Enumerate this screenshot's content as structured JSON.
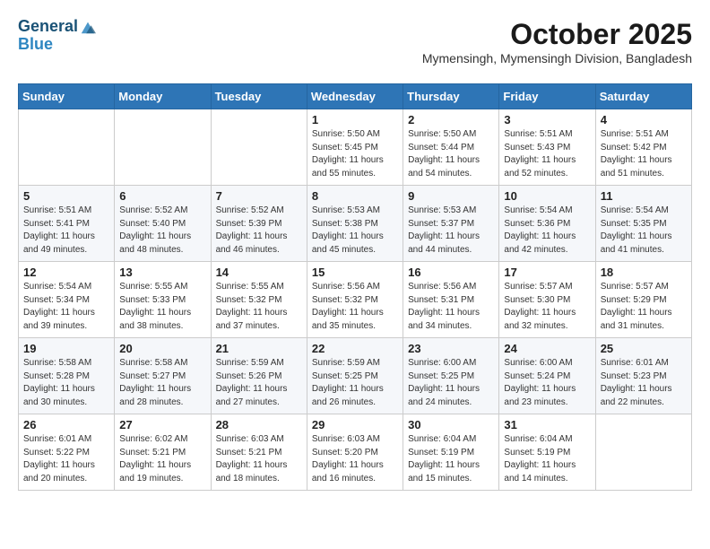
{
  "header": {
    "logo_line1": "General",
    "logo_line2": "Blue",
    "title": "October 2025",
    "subtitle": "Mymensingh, Mymensingh Division, Bangladesh"
  },
  "weekdays": [
    "Sunday",
    "Monday",
    "Tuesday",
    "Wednesday",
    "Thursday",
    "Friday",
    "Saturday"
  ],
  "weeks": [
    [
      {
        "day": "",
        "info": ""
      },
      {
        "day": "",
        "info": ""
      },
      {
        "day": "",
        "info": ""
      },
      {
        "day": "1",
        "info": "Sunrise: 5:50 AM\nSunset: 5:45 PM\nDaylight: 11 hours\nand 55 minutes."
      },
      {
        "day": "2",
        "info": "Sunrise: 5:50 AM\nSunset: 5:44 PM\nDaylight: 11 hours\nand 54 minutes."
      },
      {
        "day": "3",
        "info": "Sunrise: 5:51 AM\nSunset: 5:43 PM\nDaylight: 11 hours\nand 52 minutes."
      },
      {
        "day": "4",
        "info": "Sunrise: 5:51 AM\nSunset: 5:42 PM\nDaylight: 11 hours\nand 51 minutes."
      }
    ],
    [
      {
        "day": "5",
        "info": "Sunrise: 5:51 AM\nSunset: 5:41 PM\nDaylight: 11 hours\nand 49 minutes."
      },
      {
        "day": "6",
        "info": "Sunrise: 5:52 AM\nSunset: 5:40 PM\nDaylight: 11 hours\nand 48 minutes."
      },
      {
        "day": "7",
        "info": "Sunrise: 5:52 AM\nSunset: 5:39 PM\nDaylight: 11 hours\nand 46 minutes."
      },
      {
        "day": "8",
        "info": "Sunrise: 5:53 AM\nSunset: 5:38 PM\nDaylight: 11 hours\nand 45 minutes."
      },
      {
        "day": "9",
        "info": "Sunrise: 5:53 AM\nSunset: 5:37 PM\nDaylight: 11 hours\nand 44 minutes."
      },
      {
        "day": "10",
        "info": "Sunrise: 5:54 AM\nSunset: 5:36 PM\nDaylight: 11 hours\nand 42 minutes."
      },
      {
        "day": "11",
        "info": "Sunrise: 5:54 AM\nSunset: 5:35 PM\nDaylight: 11 hours\nand 41 minutes."
      }
    ],
    [
      {
        "day": "12",
        "info": "Sunrise: 5:54 AM\nSunset: 5:34 PM\nDaylight: 11 hours\nand 39 minutes."
      },
      {
        "day": "13",
        "info": "Sunrise: 5:55 AM\nSunset: 5:33 PM\nDaylight: 11 hours\nand 38 minutes."
      },
      {
        "day": "14",
        "info": "Sunrise: 5:55 AM\nSunset: 5:32 PM\nDaylight: 11 hours\nand 37 minutes."
      },
      {
        "day": "15",
        "info": "Sunrise: 5:56 AM\nSunset: 5:32 PM\nDaylight: 11 hours\nand 35 minutes."
      },
      {
        "day": "16",
        "info": "Sunrise: 5:56 AM\nSunset: 5:31 PM\nDaylight: 11 hours\nand 34 minutes."
      },
      {
        "day": "17",
        "info": "Sunrise: 5:57 AM\nSunset: 5:30 PM\nDaylight: 11 hours\nand 32 minutes."
      },
      {
        "day": "18",
        "info": "Sunrise: 5:57 AM\nSunset: 5:29 PM\nDaylight: 11 hours\nand 31 minutes."
      }
    ],
    [
      {
        "day": "19",
        "info": "Sunrise: 5:58 AM\nSunset: 5:28 PM\nDaylight: 11 hours\nand 30 minutes."
      },
      {
        "day": "20",
        "info": "Sunrise: 5:58 AM\nSunset: 5:27 PM\nDaylight: 11 hours\nand 28 minutes."
      },
      {
        "day": "21",
        "info": "Sunrise: 5:59 AM\nSunset: 5:26 PM\nDaylight: 11 hours\nand 27 minutes."
      },
      {
        "day": "22",
        "info": "Sunrise: 5:59 AM\nSunset: 5:25 PM\nDaylight: 11 hours\nand 26 minutes."
      },
      {
        "day": "23",
        "info": "Sunrise: 6:00 AM\nSunset: 5:25 PM\nDaylight: 11 hours\nand 24 minutes."
      },
      {
        "day": "24",
        "info": "Sunrise: 6:00 AM\nSunset: 5:24 PM\nDaylight: 11 hours\nand 23 minutes."
      },
      {
        "day": "25",
        "info": "Sunrise: 6:01 AM\nSunset: 5:23 PM\nDaylight: 11 hours\nand 22 minutes."
      }
    ],
    [
      {
        "day": "26",
        "info": "Sunrise: 6:01 AM\nSunset: 5:22 PM\nDaylight: 11 hours\nand 20 minutes."
      },
      {
        "day": "27",
        "info": "Sunrise: 6:02 AM\nSunset: 5:21 PM\nDaylight: 11 hours\nand 19 minutes."
      },
      {
        "day": "28",
        "info": "Sunrise: 6:03 AM\nSunset: 5:21 PM\nDaylight: 11 hours\nand 18 minutes."
      },
      {
        "day": "29",
        "info": "Sunrise: 6:03 AM\nSunset: 5:20 PM\nDaylight: 11 hours\nand 16 minutes."
      },
      {
        "day": "30",
        "info": "Sunrise: 6:04 AM\nSunset: 5:19 PM\nDaylight: 11 hours\nand 15 minutes."
      },
      {
        "day": "31",
        "info": "Sunrise: 6:04 AM\nSunset: 5:19 PM\nDaylight: 11 hours\nand 14 minutes."
      },
      {
        "day": "",
        "info": ""
      }
    ]
  ]
}
